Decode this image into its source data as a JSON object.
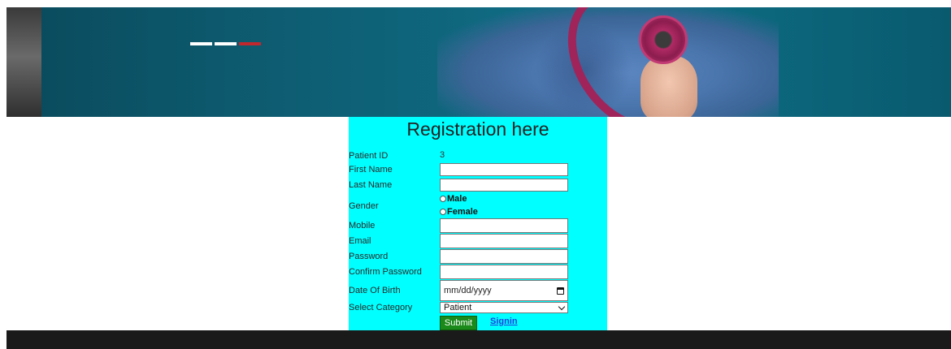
{
  "form": {
    "title": "Registration here",
    "patient_id": {
      "label": "Patient ID",
      "value": "3"
    },
    "first_name": {
      "label": "First Name",
      "value": ""
    },
    "last_name": {
      "label": "Last Name",
      "value": ""
    },
    "gender": {
      "label": "Gender",
      "options": [
        "Male",
        "Female"
      ]
    },
    "mobile": {
      "label": "Mobile",
      "value": ""
    },
    "email": {
      "label": "Email",
      "value": ""
    },
    "password": {
      "label": "Password",
      "value": ""
    },
    "confirm_password": {
      "label": "Confirm Password",
      "value": ""
    },
    "dob": {
      "label": "Date Of Birth",
      "placeholder": "mm/dd/yyyy"
    },
    "category": {
      "label": "Select Category",
      "selected": "Patient"
    },
    "submit_label": "Submit",
    "signin_label": "Signin"
  },
  "colors": {
    "panel_bg": "#00ffff",
    "submit_bg": "#1a8a1a",
    "link": "#1f3fe0",
    "footer_bg": "#1a1a1a",
    "accent_dash": "#c1272d"
  },
  "icons": {
    "date": "calendar-icon",
    "select": "chevron-down-icon"
  }
}
